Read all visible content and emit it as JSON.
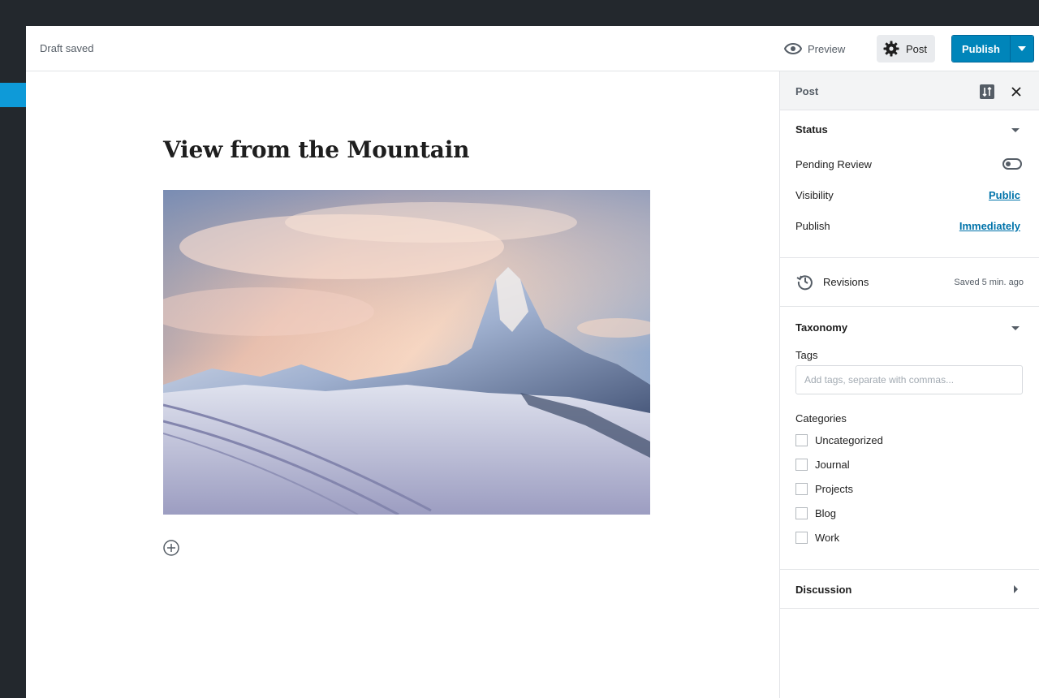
{
  "toolbar": {
    "draft_status": "Draft saved",
    "preview_label": "Preview",
    "settings_label": "Post",
    "publish_label": "Publish"
  },
  "post": {
    "title": "View from the Mountain"
  },
  "sidebar": {
    "tab_label": "Post",
    "status": {
      "title": "Status",
      "pending_review_label": "Pending Review",
      "pending_review_enabled": false,
      "visibility_label": "Visibility",
      "visibility_value": "Public",
      "publish_label": "Publish",
      "publish_value": "Immediately"
    },
    "revisions": {
      "label": "Revisions",
      "meta": "Saved 5 min. ago"
    },
    "taxonomy": {
      "title": "Taxonomy",
      "tags_label": "Tags",
      "tags_placeholder": "Add tags, separate with commas...",
      "categories_label": "Categories",
      "categories": [
        "Uncategorized",
        "Journal",
        "Projects",
        "Blog",
        "Work"
      ]
    },
    "discussion": {
      "title": "Discussion"
    }
  },
  "colors": {
    "accent": "#0085ba",
    "admin_dark": "#23282d",
    "link": "#0073aa"
  }
}
